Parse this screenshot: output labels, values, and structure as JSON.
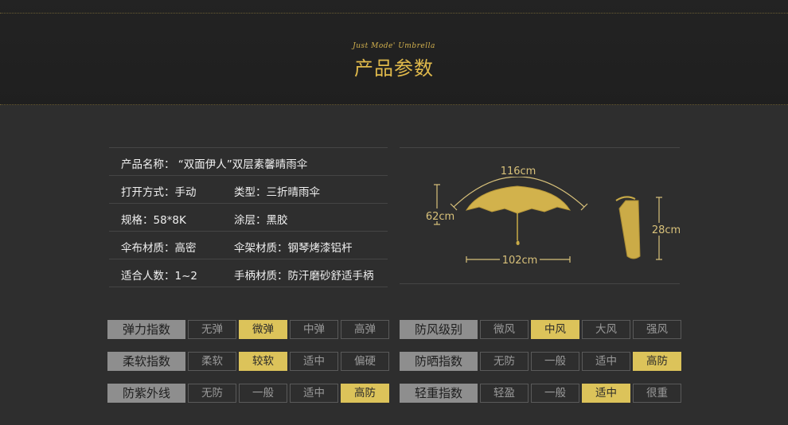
{
  "header": {
    "tagline": "Just  Mode' Umbrella",
    "title": "产品参数"
  },
  "spec": {
    "rows": [
      {
        "c1": "产品名称：  “双面伊人”双层素馨晴雨伞",
        "c2": ""
      },
      {
        "c1": "打开方式：手动",
        "c2": "类型：三折晴雨伞"
      },
      {
        "c1": "规格：58*8K",
        "c2": "涂层：黑胶"
      },
      {
        "c1": "伞布材质：高密",
        "c2": "伞架材质：钢琴烤漆铝杆"
      },
      {
        "c1": "适合人数：1~2",
        "c2": "手柄材质：防汗磨砂舒适手柄"
      }
    ]
  },
  "dims": {
    "width_open": "116cm",
    "height_open": "62cm",
    "shaft": "102cm",
    "folded": "28cm"
  },
  "colors": {
    "accent": "#dcc35a",
    "title": "#e0b94b",
    "label_bg": "#8e8e8e"
  },
  "ratings": [
    {
      "label": "弹力指数",
      "options": [
        "无弹",
        "微弹",
        "中弹",
        "高弹"
      ],
      "selected": 1
    },
    {
      "label": "柔软指数",
      "options": [
        "柔软",
        "较软",
        "适中",
        "偏硬"
      ],
      "selected": 1
    },
    {
      "label": "防紫外线",
      "options": [
        "无防",
        "一般",
        "适中",
        "高防"
      ],
      "selected": 3
    },
    {
      "label": "防风级别",
      "options": [
        "微风",
        "中风",
        "大风",
        "强风"
      ],
      "selected": 1
    },
    {
      "label": "防晒指数",
      "options": [
        "无防",
        "一般",
        "适中",
        "高防"
      ],
      "selected": 3
    },
    {
      "label": "轻重指数",
      "options": [
        "轻盈",
        "一般",
        "适中",
        "很重"
      ],
      "selected": 2
    }
  ]
}
